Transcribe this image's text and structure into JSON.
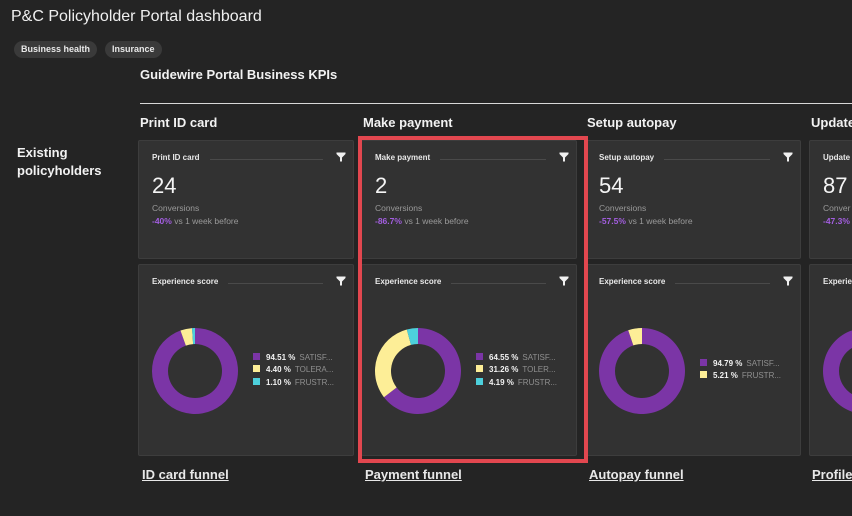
{
  "page": {
    "title": "P&C Policyholder Portal dashboard",
    "tags": [
      "Business health",
      "Insurance"
    ],
    "section_title": "Guidewire Portal Business KPIs",
    "row_label": "Existing policyholders"
  },
  "colors": {
    "satisfied": "#7b35a6",
    "tolerating": "#fdee97",
    "frustrated": "#4dd0dc",
    "change_negative": "#a35ee0",
    "highlight": "#e2474f"
  },
  "icons": {
    "filter": "filter-icon"
  },
  "columns": [
    {
      "title": "Print ID card",
      "kpi": {
        "name": "Print ID card",
        "value": "24",
        "label": "Conversions",
        "change": "-40%",
        "change_suffix": "vs 1 week before"
      },
      "experience": {
        "name": "Experience score",
        "segments": [
          {
            "value": 94.51,
            "label": "94.51 %",
            "name": "SATISF...",
            "color_key": "satisfied"
          },
          {
            "value": 4.4,
            "label": "4.40 %",
            "name": "TOLERA...",
            "color_key": "tolerating"
          },
          {
            "value": 1.1,
            "label": "1.10 %",
            "name": "FRUSTR...",
            "color_key": "frustrated"
          }
        ]
      },
      "funnel_link": "ID card funnel"
    },
    {
      "title": "Make payment",
      "kpi": {
        "name": "Make payment",
        "value": "2",
        "label": "Conversions",
        "change": "-86.7%",
        "change_suffix": "vs 1 week before"
      },
      "experience": {
        "name": "Experience score",
        "segments": [
          {
            "value": 64.55,
            "label": "64.55 %",
            "name": "SATISF...",
            "color_key": "satisfied"
          },
          {
            "value": 31.26,
            "label": "31.26 %",
            "name": "TOLER...",
            "color_key": "tolerating"
          },
          {
            "value": 4.19,
            "label": "4.19 %",
            "name": "FRUSTR...",
            "color_key": "frustrated"
          }
        ]
      },
      "funnel_link": "Payment funnel"
    },
    {
      "title": "Setup autopay",
      "kpi": {
        "name": "Setup autopay",
        "value": "54",
        "label": "Conversions",
        "change": "-57.5%",
        "change_suffix": "vs 1 week before"
      },
      "experience": {
        "name": "Experience score",
        "segments": [
          {
            "value": 94.79,
            "label": "94.79 %",
            "name": "SATISF...",
            "color_key": "satisfied"
          },
          {
            "value": 5.21,
            "label": "5.21 %",
            "name": "FRUSTR...",
            "color_key": "tolerating"
          }
        ]
      },
      "funnel_link": "Autopay funnel"
    },
    {
      "title": "Update",
      "kpi": {
        "name": "Update",
        "value": "87",
        "label": "Conver",
        "change": "-47.3%",
        "change_suffix": ""
      },
      "experience": {
        "name": "Experie",
        "segments": [
          {
            "value": 100,
            "label": "",
            "name": "",
            "color_key": "satisfied"
          }
        ]
      },
      "funnel_link": "Profile"
    }
  ]
}
